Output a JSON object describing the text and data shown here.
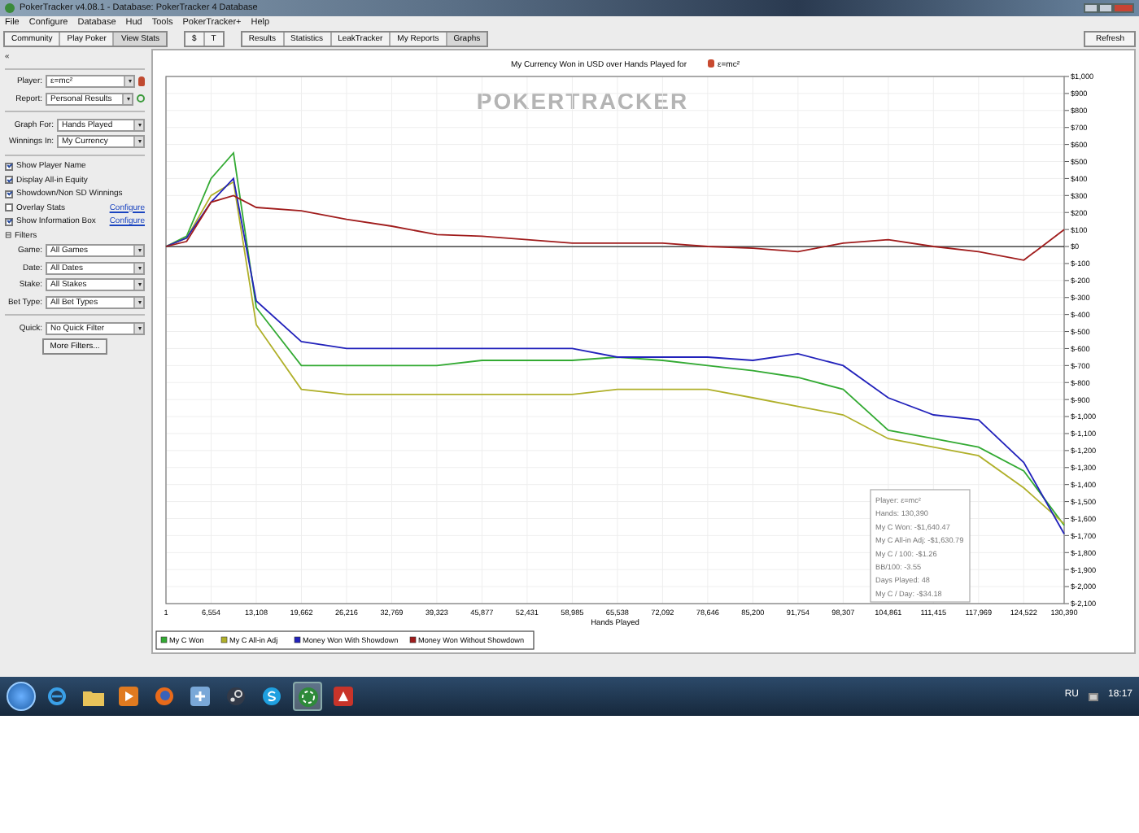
{
  "window": {
    "title": "PokerTracker v4.08.1 - Database: PokerTracker 4 Database"
  },
  "menu": [
    "File",
    "Configure",
    "Database",
    "Hud",
    "Tools",
    "PokerTracker+",
    "Help"
  ],
  "toolbar": {
    "mode_tabs": [
      {
        "label": "Community",
        "selected": false
      },
      {
        "label": "Play Poker",
        "selected": false
      },
      {
        "label": "View Stats",
        "selected": true
      }
    ],
    "currency_tabs": [
      {
        "label": "$",
        "selected": false
      },
      {
        "label": "T",
        "selected": false
      }
    ],
    "view_tabs": [
      {
        "label": "Results",
        "selected": false
      },
      {
        "label": "Statistics",
        "selected": false
      },
      {
        "label": "LeakTracker",
        "selected": false
      },
      {
        "label": "My Reports",
        "selected": false
      },
      {
        "label": "Graphs",
        "selected": true
      }
    ],
    "refresh": "Refresh"
  },
  "sidebar": {
    "collapse": "«",
    "selectors": [
      {
        "label": "Player:",
        "value": "ε=mc²"
      },
      {
        "label": "Report:",
        "value": "Personal Results"
      }
    ],
    "graph_options": [
      {
        "label": "Graph For:",
        "value": "Hands Played"
      },
      {
        "label": "Winnings In:",
        "value": "My Currency"
      }
    ],
    "checkboxes": [
      {
        "label": "Show Player Name",
        "checked": true
      },
      {
        "label": "Display All-in Equity",
        "checked": true
      },
      {
        "label": "Showdown/Non SD Winnings",
        "checked": true
      },
      {
        "label": "Overlay Stats",
        "checked": false,
        "link": "Configure"
      },
      {
        "label": "Show Information Box",
        "checked": true,
        "link": "Configure"
      }
    ],
    "filters_toggle": "⊟",
    "filters_header": "Filters",
    "filters": [
      {
        "label": "Game:",
        "value": "All Games"
      },
      {
        "label": "Date:",
        "value": "All Dates"
      },
      {
        "label": "Stake:",
        "value": "All Stakes"
      },
      {
        "label": "Bet Type:",
        "value": "All Bet Types"
      }
    ],
    "quick": {
      "label": "Quick:",
      "value": "No Quick Filter"
    },
    "more_filters": "More Filters..."
  },
  "graph": {
    "title": "My Currency Won in USD over Hands Played for",
    "player": "ε=mc²",
    "watermark": "POKERTRACKER",
    "chart_data": {
      "type": "line",
      "xlabel": "Hands Played",
      "grid": true,
      "legend": true,
      "x": [
        1,
        3000,
        6554,
        9800,
        13108,
        19662,
        26216,
        32769,
        39323,
        45877,
        52431,
        58985,
        65538,
        72092,
        78646,
        85200,
        91754,
        98307,
        104861,
        111415,
        117969,
        124522,
        130390
      ],
      "series": [
        {
          "name": "My C Won",
          "color": "#33aa33",
          "values": [
            0,
            60,
            400,
            550,
            -360,
            -700,
            -700,
            -700,
            -700,
            -670,
            -670,
            -670,
            -650,
            -670,
            -700,
            -730,
            -770,
            -840,
            -1080,
            -1130,
            -1180,
            -1320,
            -1640
          ]
        },
        {
          "name": "My C All-in Adj",
          "color": "#b0b02a",
          "values": [
            0,
            50,
            300,
            380,
            -460,
            -840,
            -870,
            -870,
            -870,
            -870,
            -870,
            -870,
            -840,
            -840,
            -840,
            -890,
            -940,
            -990,
            -1130,
            -1180,
            -1230,
            -1420,
            -1630
          ]
        },
        {
          "name": "Money Won With Showdown",
          "color": "#2222bb",
          "values": [
            0,
            50,
            260,
            400,
            -320,
            -560,
            -600,
            -600,
            -600,
            -600,
            -600,
            -600,
            -650,
            -650,
            -650,
            -670,
            -630,
            -700,
            -890,
            -990,
            -1020,
            -1270,
            -1690
          ]
        },
        {
          "name": "Money Won Without Showdown",
          "color": "#a01c1c",
          "values": [
            0,
            30,
            260,
            300,
            230,
            210,
            160,
            120,
            70,
            60,
            40,
            20,
            20,
            20,
            0,
            -10,
            -30,
            20,
            40,
            0,
            -30,
            -80,
            100
          ]
        }
      ],
      "xlim": [
        1,
        130390
      ],
      "ylim": [
        -2100,
        1000
      ],
      "xticks": [
        {
          "value": 1,
          "label": "1"
        },
        {
          "value": 6554,
          "label": "6,554"
        },
        {
          "value": 13108,
          "label": "13,108"
        },
        {
          "value": 19662,
          "label": "19,662"
        },
        {
          "value": 26216,
          "label": "26,216"
        },
        {
          "value": 32769,
          "label": "32,769"
        },
        {
          "value": 39323,
          "label": "39,323"
        },
        {
          "value": 45877,
          "label": "45,877"
        },
        {
          "value": 52431,
          "label": "52,431"
        },
        {
          "value": 58985,
          "label": "58,985"
        },
        {
          "value": 65538,
          "label": "65,538"
        },
        {
          "value": 72092,
          "label": "72,092"
        },
        {
          "value": 78646,
          "label": "78,646"
        },
        {
          "value": 85200,
          "label": "85,200"
        },
        {
          "value": 91754,
          "label": "91,754"
        },
        {
          "value": 98307,
          "label": "98,307"
        },
        {
          "value": 104861,
          "label": "104,861"
        },
        {
          "value": 111415,
          "label": "111,415"
        },
        {
          "value": 117969,
          "label": "117,969"
        },
        {
          "value": 124522,
          "label": "124,522"
        },
        {
          "value": 130390,
          "label": "130,390"
        }
      ],
      "yticks": [
        {
          "value": 1000,
          "label": "$1,000"
        },
        {
          "value": 900,
          "label": "$900"
        },
        {
          "value": 800,
          "label": "$800"
        },
        {
          "value": 700,
          "label": "$700"
        },
        {
          "value": 600,
          "label": "$600"
        },
        {
          "value": 500,
          "label": "$500"
        },
        {
          "value": 400,
          "label": "$400"
        },
        {
          "value": 300,
          "label": "$300"
        },
        {
          "value": 200,
          "label": "$200"
        },
        {
          "value": 100,
          "label": "$100"
        },
        {
          "value": 0,
          "label": "$0"
        },
        {
          "value": -100,
          "label": "$-100"
        },
        {
          "value": -200,
          "label": "$-200"
        },
        {
          "value": -300,
          "label": "$-300"
        },
        {
          "value": -400,
          "label": "$-400"
        },
        {
          "value": -500,
          "label": "$-500"
        },
        {
          "value": -600,
          "label": "$-600"
        },
        {
          "value": -700,
          "label": "$-700"
        },
        {
          "value": -800,
          "label": "$-800"
        },
        {
          "value": -900,
          "label": "$-900"
        },
        {
          "value": -1000,
          "label": "$-1,000"
        },
        {
          "value": -1100,
          "label": "$-1,100"
        },
        {
          "value": -1200,
          "label": "$-1,200"
        },
        {
          "value": -1300,
          "label": "$-1,300"
        },
        {
          "value": -1400,
          "label": "$-1,400"
        },
        {
          "value": -1500,
          "label": "$-1,500"
        },
        {
          "value": -1600,
          "label": "$-1,600"
        },
        {
          "value": -1700,
          "label": "$-1,700"
        },
        {
          "value": -1800,
          "label": "$-1,800"
        },
        {
          "value": -1900,
          "label": "$-1,900"
        },
        {
          "value": -2000,
          "label": "$-2,000"
        },
        {
          "value": -2100,
          "label": "$-2,100"
        }
      ]
    },
    "info_box": [
      "Player: ε=mc²",
      "Hands: 130,390",
      "My C Won: -$1,640.47",
      "My C All-in Adj: -$1,630.79",
      "My C / 100: -$1.26",
      "BB/100: -3.55",
      "Days Played: 48",
      "My C / Day: -$34.18"
    ]
  },
  "taskbar": {
    "apps": [
      {
        "kind": "ie",
        "selected": false
      },
      {
        "kind": "folder",
        "selected": false
      },
      {
        "kind": "media",
        "selected": false
      },
      {
        "kind": "firefox",
        "selected": false
      },
      {
        "kind": "app",
        "selected": false
      },
      {
        "kind": "steam",
        "selected": false
      },
      {
        "kind": "skype",
        "selected": false
      },
      {
        "kind": "chip",
        "selected": true
      },
      {
        "kind": "tool",
        "selected": false
      }
    ],
    "language": "RU",
    "time": "18:17"
  }
}
